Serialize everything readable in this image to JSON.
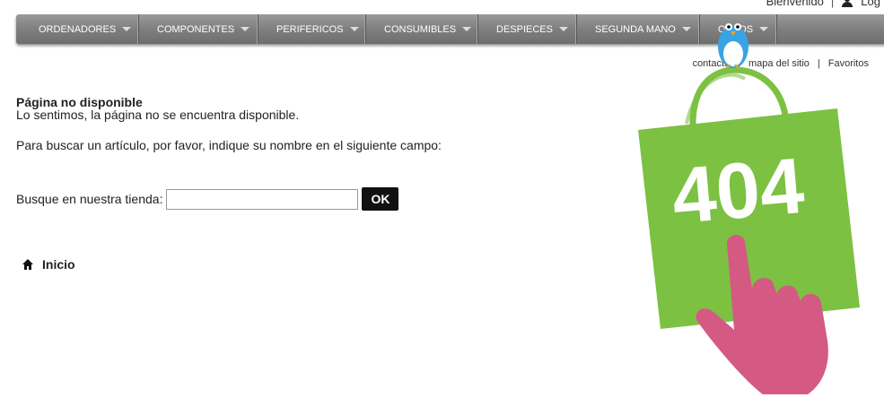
{
  "topbar": {
    "welcome": "Bienvenido",
    "separator": "|",
    "login": "Log"
  },
  "nav": [
    {
      "label": "ORDENADORES"
    },
    {
      "label": "COMPONENTES"
    },
    {
      "label": "PERIFERICOS"
    },
    {
      "label": "CONSUMIBLES"
    },
    {
      "label": "DESPIECES"
    },
    {
      "label": "SEGUNDA MANO"
    },
    {
      "label": "OTROS"
    }
  ],
  "links": {
    "contact": "contacto",
    "sitemap": "mapa del sitio",
    "favorites": "Favoritos",
    "separator": "|"
  },
  "content": {
    "title": "Página no disponible",
    "message": "Lo sentimos, la página no se encuentra disponible.",
    "instruction": "Para buscar un artículo, por favor, indique su nombre en el siguiente campo:",
    "search_label": "Busque en nuestra tienda:",
    "search_value": "",
    "ok_label": "OK",
    "home_label": "Inicio"
  },
  "illustration": {
    "bag_text": "404",
    "colors": {
      "bag": "#7cc142",
      "hand": "#d45a84",
      "bird": "#3aa3e3"
    }
  }
}
